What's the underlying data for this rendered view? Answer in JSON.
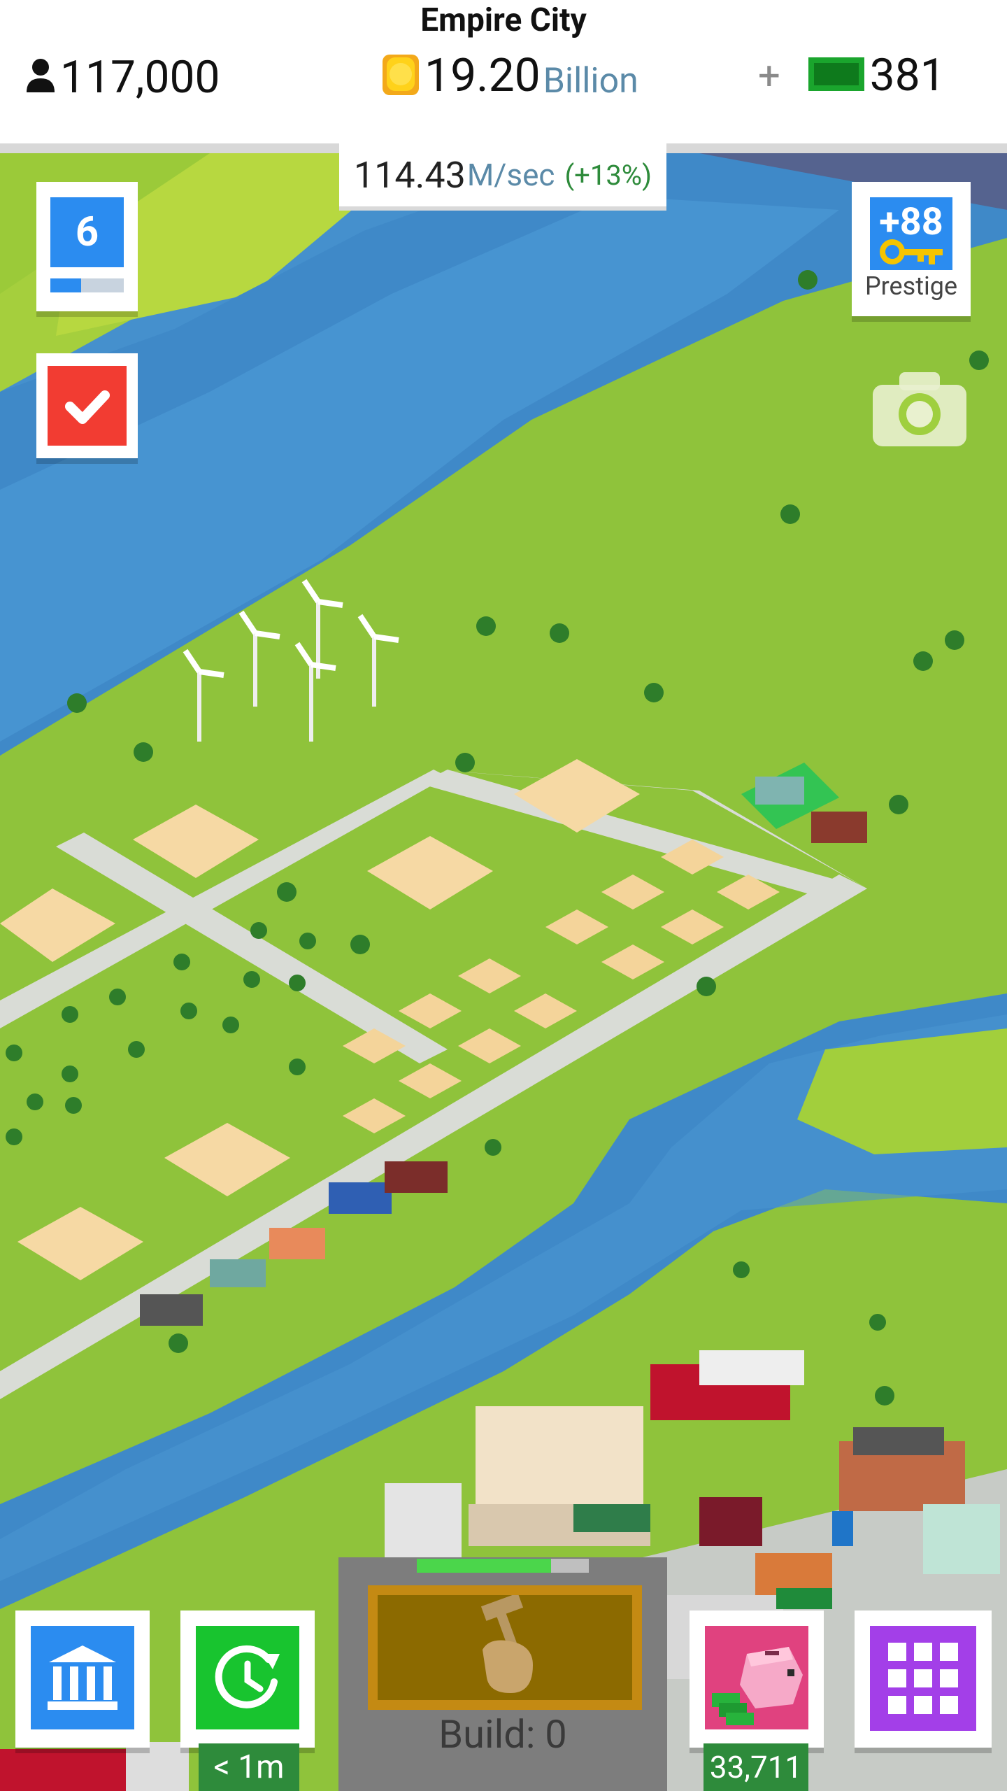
{
  "header": {
    "city_name": "Empire City",
    "population": "117,000",
    "coins": "19.20",
    "coins_unit": "Billion",
    "plus": "+",
    "cash": "381"
  },
  "income": {
    "value": "114.43",
    "unit": "M/sec",
    "bonus": "(+13%)"
  },
  "level": {
    "value": "6",
    "progress": 0.42
  },
  "prestige": {
    "amount": "+88",
    "label": "Prestige"
  },
  "build": {
    "label": "Build: 0",
    "progress": 0.78
  },
  "boost": {
    "timer": "< 1m"
  },
  "piggy_bank": {
    "amount": "33,711"
  },
  "icons": [
    "person-icon",
    "coin-icon",
    "cash-icon",
    "checkmark-icon",
    "key-icon",
    "camera-icon",
    "bank-icon",
    "clock-refresh-icon",
    "hammer-hand-icon",
    "piggy-bank-icon",
    "grid-menu-icon"
  ],
  "colors": {
    "accent_blue": "#2b8cf0",
    "task_red": "#f23c32",
    "boost_green": "#18c42f",
    "menu_purple": "#a33fe8",
    "piggy_pink": "#e0427f",
    "label_green": "#2e8b3b",
    "grass": "#8cc43a",
    "water": "#3b86c6"
  }
}
